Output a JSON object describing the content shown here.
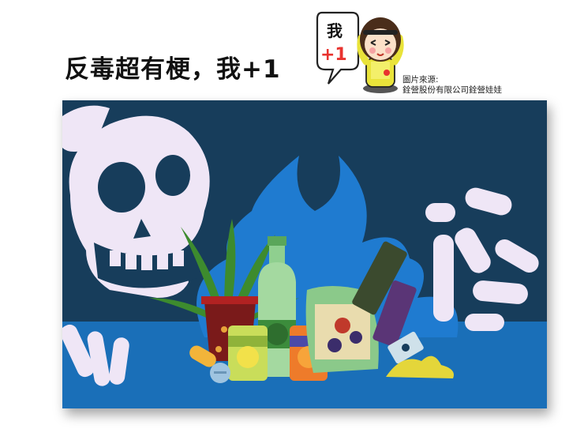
{
  "headline": "反毒超有梗，我+1",
  "mascot": {
    "bubble_top": "我",
    "bubble_bottom": "+1"
  },
  "credit": {
    "line1": "圖片來源:",
    "line2": "銓營股份有限公司銓營娃娃"
  },
  "colors": {
    "sky": "#173d5b",
    "floor": "#1a6fb8",
    "flame": "#1f7bd0",
    "bone": "#efe6f6"
  }
}
